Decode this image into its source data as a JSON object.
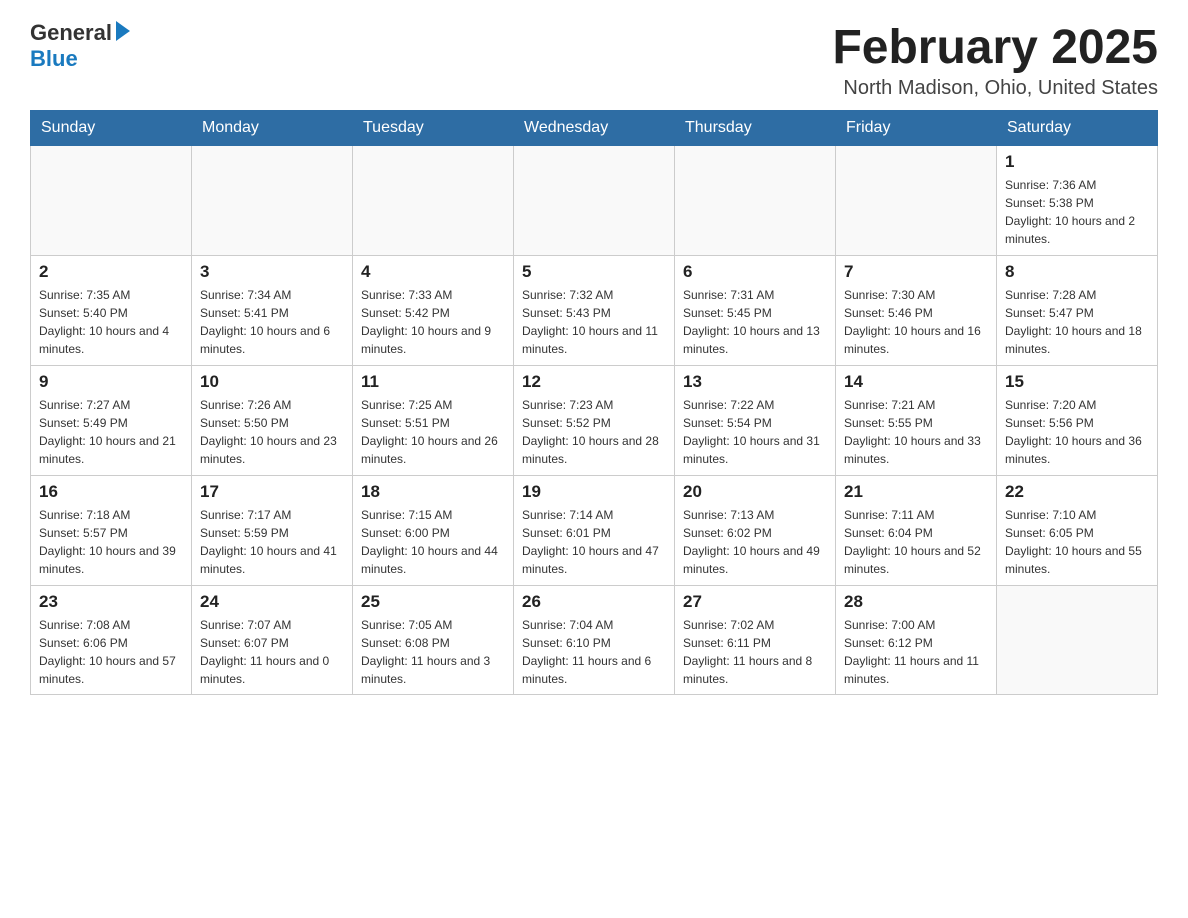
{
  "header": {
    "logo_general": "General",
    "logo_blue": "Blue",
    "month_title": "February 2025",
    "location": "North Madison, Ohio, United States"
  },
  "weekdays": [
    "Sunday",
    "Monday",
    "Tuesday",
    "Wednesday",
    "Thursday",
    "Friday",
    "Saturday"
  ],
  "weeks": [
    [
      {
        "day": "",
        "info": ""
      },
      {
        "day": "",
        "info": ""
      },
      {
        "day": "",
        "info": ""
      },
      {
        "day": "",
        "info": ""
      },
      {
        "day": "",
        "info": ""
      },
      {
        "day": "",
        "info": ""
      },
      {
        "day": "1",
        "info": "Sunrise: 7:36 AM\nSunset: 5:38 PM\nDaylight: 10 hours and 2 minutes."
      }
    ],
    [
      {
        "day": "2",
        "info": "Sunrise: 7:35 AM\nSunset: 5:40 PM\nDaylight: 10 hours and 4 minutes."
      },
      {
        "day": "3",
        "info": "Sunrise: 7:34 AM\nSunset: 5:41 PM\nDaylight: 10 hours and 6 minutes."
      },
      {
        "day": "4",
        "info": "Sunrise: 7:33 AM\nSunset: 5:42 PM\nDaylight: 10 hours and 9 minutes."
      },
      {
        "day": "5",
        "info": "Sunrise: 7:32 AM\nSunset: 5:43 PM\nDaylight: 10 hours and 11 minutes."
      },
      {
        "day": "6",
        "info": "Sunrise: 7:31 AM\nSunset: 5:45 PM\nDaylight: 10 hours and 13 minutes."
      },
      {
        "day": "7",
        "info": "Sunrise: 7:30 AM\nSunset: 5:46 PM\nDaylight: 10 hours and 16 minutes."
      },
      {
        "day": "8",
        "info": "Sunrise: 7:28 AM\nSunset: 5:47 PM\nDaylight: 10 hours and 18 minutes."
      }
    ],
    [
      {
        "day": "9",
        "info": "Sunrise: 7:27 AM\nSunset: 5:49 PM\nDaylight: 10 hours and 21 minutes."
      },
      {
        "day": "10",
        "info": "Sunrise: 7:26 AM\nSunset: 5:50 PM\nDaylight: 10 hours and 23 minutes."
      },
      {
        "day": "11",
        "info": "Sunrise: 7:25 AM\nSunset: 5:51 PM\nDaylight: 10 hours and 26 minutes."
      },
      {
        "day": "12",
        "info": "Sunrise: 7:23 AM\nSunset: 5:52 PM\nDaylight: 10 hours and 28 minutes."
      },
      {
        "day": "13",
        "info": "Sunrise: 7:22 AM\nSunset: 5:54 PM\nDaylight: 10 hours and 31 minutes."
      },
      {
        "day": "14",
        "info": "Sunrise: 7:21 AM\nSunset: 5:55 PM\nDaylight: 10 hours and 33 minutes."
      },
      {
        "day": "15",
        "info": "Sunrise: 7:20 AM\nSunset: 5:56 PM\nDaylight: 10 hours and 36 minutes."
      }
    ],
    [
      {
        "day": "16",
        "info": "Sunrise: 7:18 AM\nSunset: 5:57 PM\nDaylight: 10 hours and 39 minutes."
      },
      {
        "day": "17",
        "info": "Sunrise: 7:17 AM\nSunset: 5:59 PM\nDaylight: 10 hours and 41 minutes."
      },
      {
        "day": "18",
        "info": "Sunrise: 7:15 AM\nSunset: 6:00 PM\nDaylight: 10 hours and 44 minutes."
      },
      {
        "day": "19",
        "info": "Sunrise: 7:14 AM\nSunset: 6:01 PM\nDaylight: 10 hours and 47 minutes."
      },
      {
        "day": "20",
        "info": "Sunrise: 7:13 AM\nSunset: 6:02 PM\nDaylight: 10 hours and 49 minutes."
      },
      {
        "day": "21",
        "info": "Sunrise: 7:11 AM\nSunset: 6:04 PM\nDaylight: 10 hours and 52 minutes."
      },
      {
        "day": "22",
        "info": "Sunrise: 7:10 AM\nSunset: 6:05 PM\nDaylight: 10 hours and 55 minutes."
      }
    ],
    [
      {
        "day": "23",
        "info": "Sunrise: 7:08 AM\nSunset: 6:06 PM\nDaylight: 10 hours and 57 minutes."
      },
      {
        "day": "24",
        "info": "Sunrise: 7:07 AM\nSunset: 6:07 PM\nDaylight: 11 hours and 0 minutes."
      },
      {
        "day": "25",
        "info": "Sunrise: 7:05 AM\nSunset: 6:08 PM\nDaylight: 11 hours and 3 minutes."
      },
      {
        "day": "26",
        "info": "Sunrise: 7:04 AM\nSunset: 6:10 PM\nDaylight: 11 hours and 6 minutes."
      },
      {
        "day": "27",
        "info": "Sunrise: 7:02 AM\nSunset: 6:11 PM\nDaylight: 11 hours and 8 minutes."
      },
      {
        "day": "28",
        "info": "Sunrise: 7:00 AM\nSunset: 6:12 PM\nDaylight: 11 hours and 11 minutes."
      },
      {
        "day": "",
        "info": ""
      }
    ]
  ]
}
